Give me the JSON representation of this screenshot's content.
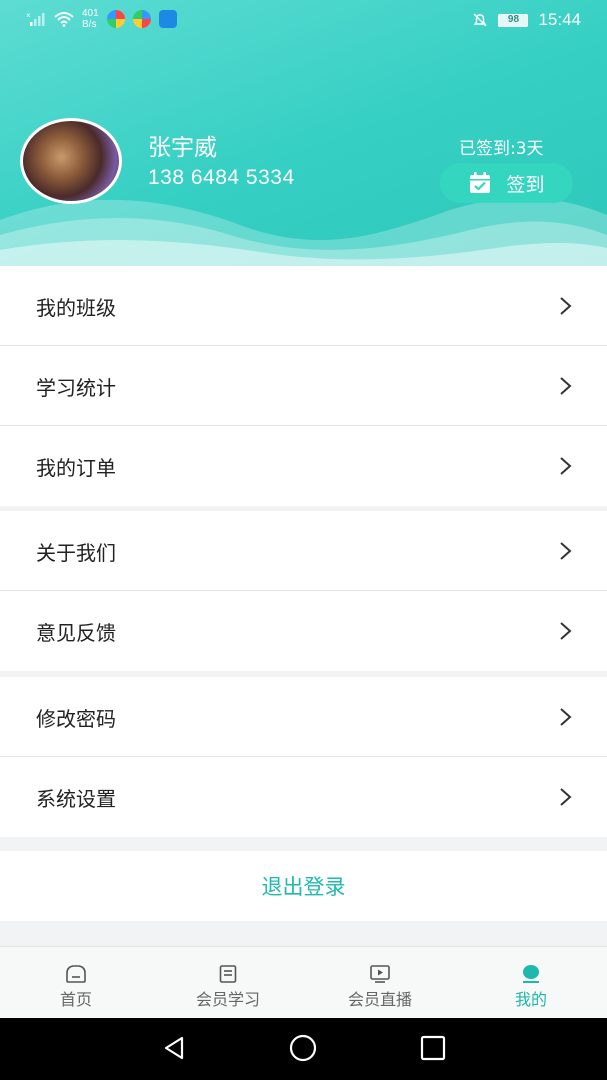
{
  "status_bar": {
    "network_speed_value": "401",
    "network_speed_unit": "B/s",
    "battery": "98",
    "time": "15:44"
  },
  "profile": {
    "name": "张宇威",
    "phone": "138 6484 5334",
    "signed_days": "已签到:3天",
    "checkin_label": "签到"
  },
  "menu_groups": [
    [
      {
        "label": "我的班级"
      },
      {
        "label": "学习统计"
      },
      {
        "label": "我的订单"
      }
    ],
    [
      {
        "label": "关于我们"
      },
      {
        "label": "意见反馈"
      }
    ],
    [
      {
        "label": "修改密码"
      },
      {
        "label": "系统设置"
      }
    ]
  ],
  "logout_label": "退出登录",
  "tabs": [
    {
      "label": "首页",
      "icon": "home-icon"
    },
    {
      "label": "会员学习",
      "icon": "book-icon"
    },
    {
      "label": "会员直播",
      "icon": "live-video-icon"
    },
    {
      "label": "我的",
      "icon": "user-icon",
      "active": true
    }
  ],
  "colors": {
    "accent": "#1fb8ad",
    "header_start": "#5ddcd3",
    "header_end": "#2ec8bb"
  }
}
